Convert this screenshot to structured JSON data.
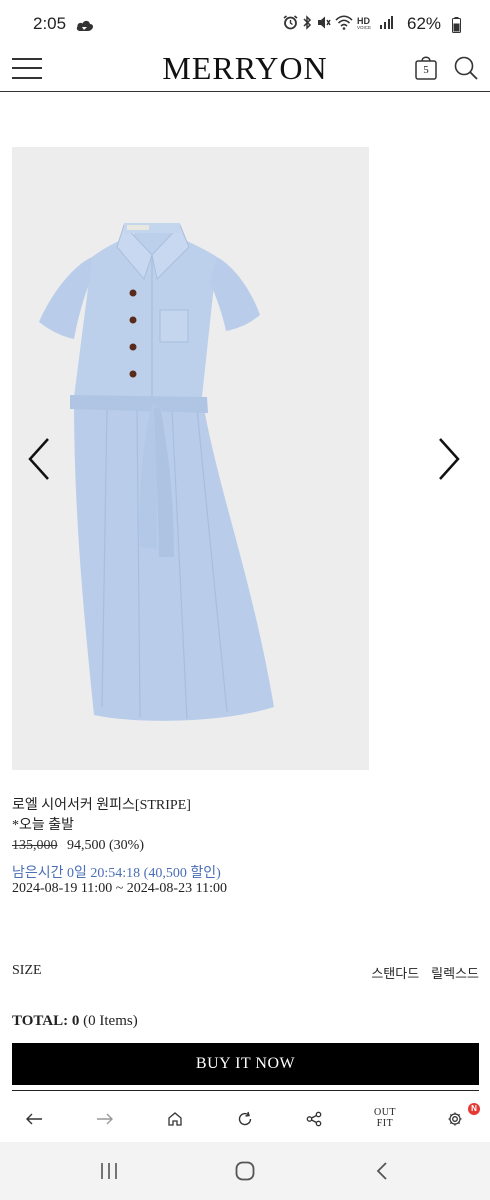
{
  "status_bar": {
    "time": "2:05",
    "battery": "62%"
  },
  "header": {
    "logo": "MERRYON",
    "cart_count": "5"
  },
  "product": {
    "name": "로엘 시어서커 원피스[STRIPE]",
    "shipping_note": "*오늘 출발",
    "original_price": "135,000",
    "sale_price": "94,500 (30%)",
    "countdown": "남은시간 0일 20:54:18 (40,500 할인)",
    "period": "2024-08-19 11:00 ~ 2024-08-23 11:00",
    "image_alt": "light blue shirt dress"
  },
  "size": {
    "label": "SIZE",
    "options": [
      "스탠다드",
      "릴렉스드"
    ]
  },
  "total": {
    "label": "TOTAL: 0",
    "items": "(0 Items)"
  },
  "buy_button": "BUY IT NOW",
  "browser_toolbar": {
    "outfit_line1": "OUT",
    "outfit_line2": "FIT",
    "badge": "N"
  },
  "colors": {
    "accent_blue": "#4a6fb5",
    "dress_blue": "#b9cdea",
    "button_black": "#000000",
    "badge_red": "#e53935"
  }
}
